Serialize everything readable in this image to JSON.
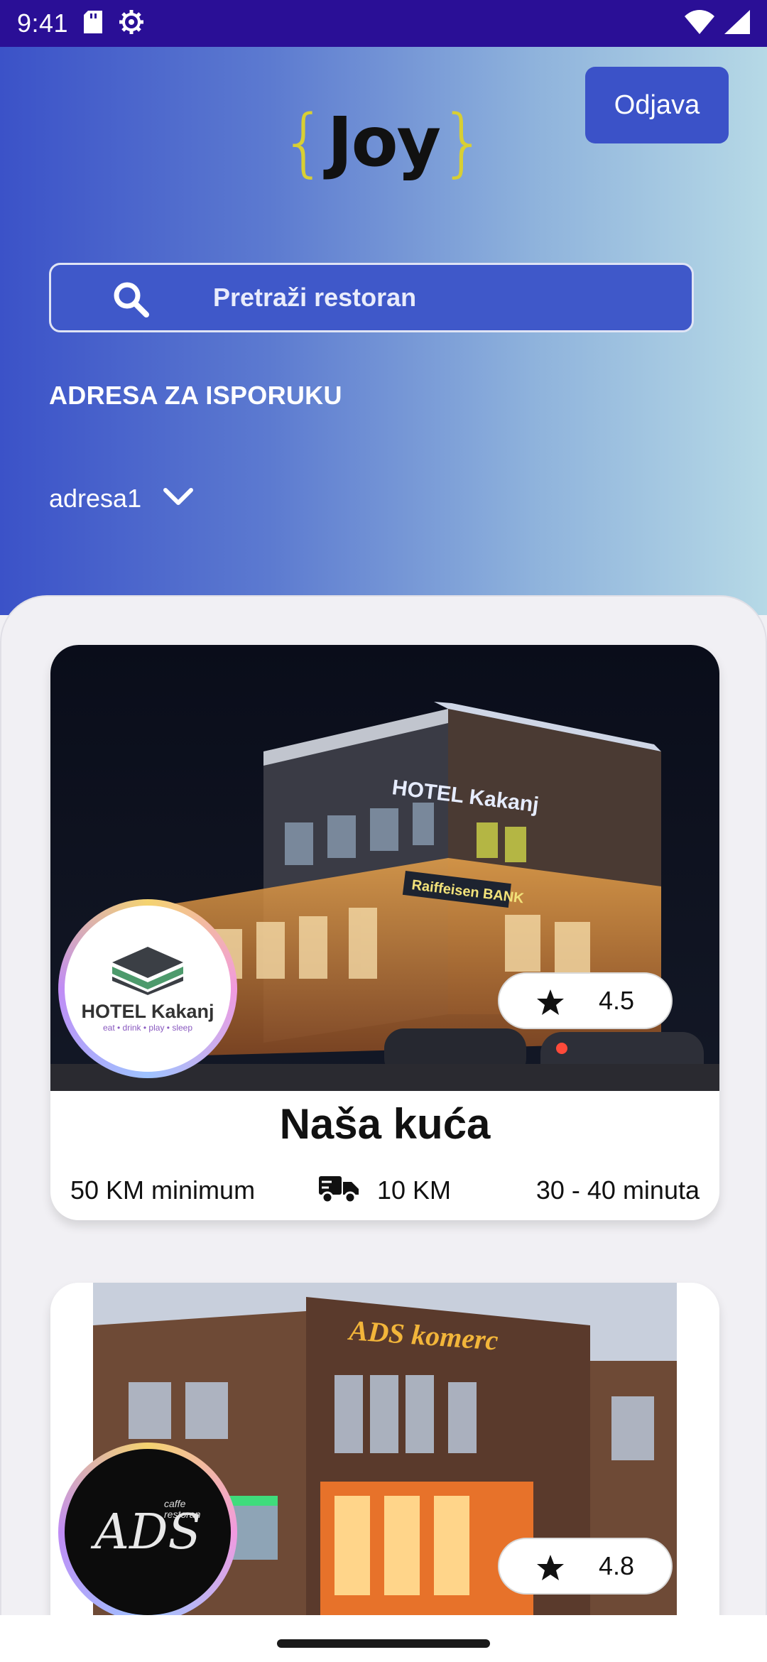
{
  "status_bar": {
    "time": "9:41"
  },
  "header": {
    "logo_open_brace": "{",
    "logo_word": "Joy",
    "logo_close_brace": "}",
    "logout_label": "Odjava"
  },
  "search": {
    "placeholder": "Pretraži restoran"
  },
  "delivery": {
    "heading": "ADRESA ZA ISPORUKU",
    "selected_address": "adresa1"
  },
  "restaurants": [
    {
      "name": "Naša kuća",
      "rating": "4.5",
      "minimum": "50 KM minimum",
      "delivery_fee": "10 KM",
      "delivery_time": "30 - 40 minuta",
      "logo_text": "HOTEL Kakanj",
      "logo_tagline": "eat • drink • play • sleep",
      "photo_sign": "HOTEL Kakanj",
      "photo_bank_sign": "Raiffeisen BANK"
    },
    {
      "name": "",
      "rating": "4.8",
      "logo_text": "ADS",
      "logo_tagline": "caffe restoran",
      "photo_sign": "ADS komerc"
    }
  ],
  "colors": {
    "status_bar": "#2a0f96",
    "accent": "#3b52c8",
    "logo_brace": "#d8cf33"
  }
}
